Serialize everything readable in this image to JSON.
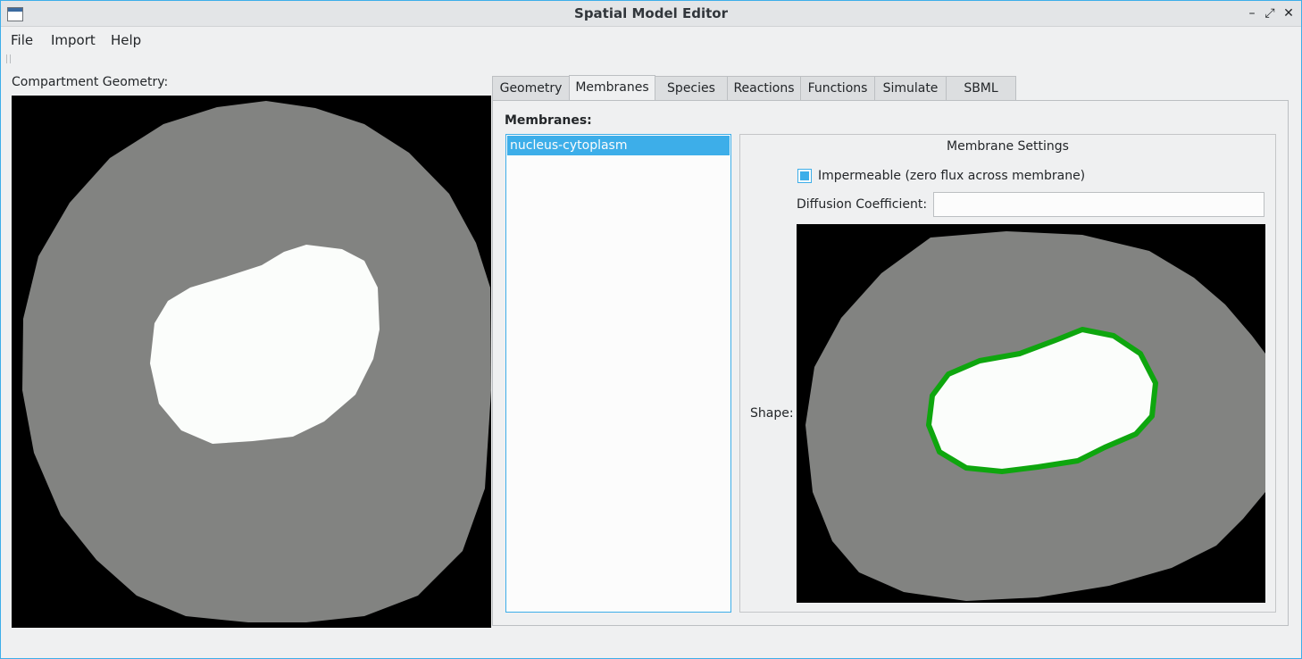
{
  "window": {
    "title": "Spatial Model Editor",
    "controls": {
      "minimize": "–",
      "restore": "⤢",
      "close": "✕"
    }
  },
  "menubar": {
    "items": [
      "File",
      "Import",
      "Help"
    ]
  },
  "geometry_panel": {
    "label": "Compartment Geometry:"
  },
  "tabs": [
    {
      "label": "Geometry",
      "active": false
    },
    {
      "label": "Membranes",
      "active": true
    },
    {
      "label": "Species",
      "active": false
    },
    {
      "label": "Reactions",
      "active": false
    },
    {
      "label": "Functions",
      "active": false
    },
    {
      "label": "Simulate",
      "active": false
    },
    {
      "label": "SBML",
      "active": false
    }
  ],
  "membranes": {
    "label": "Membranes:",
    "items": [
      "nucleus-cytoplasm"
    ],
    "selected": "nucleus-cytoplasm"
  },
  "membrane_settings": {
    "title": "Membrane Settings",
    "impermeable_label": "Impermeable (zero flux across membrane)",
    "impermeable_checked": true,
    "diffusion_label": "Diffusion Coefficient:",
    "diffusion_value": "",
    "shape_label": "Shape:"
  },
  "colors": {
    "accent": "#3daee9",
    "background": "#000000",
    "cytoplasm": "#808080",
    "nucleus": "#fbfdfb",
    "membrane": "#0ea60e"
  }
}
